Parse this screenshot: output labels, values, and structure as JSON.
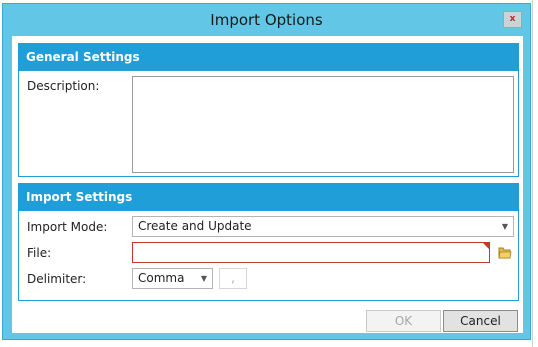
{
  "window": {
    "title": "Import Options"
  },
  "colors": {
    "frame": "#62c6e6",
    "header": "#1f9ed8",
    "error": "#c0392b"
  },
  "general": {
    "header": "General Settings",
    "description_label": "Description:",
    "description_value": ""
  },
  "import": {
    "header": "Import Settings",
    "mode_label": "Import Mode:",
    "mode_value": "Create and Update",
    "file_label": "File:",
    "file_value": "",
    "delimiter_label": "Delimiter:",
    "delimiter_value": "Comma",
    "delimiter_char": ","
  },
  "buttons": {
    "ok": "OK",
    "cancel": "Cancel"
  },
  "icons": {
    "close": "close-icon",
    "folder": "folder-icon",
    "dropdown": "chevron-down-icon"
  }
}
